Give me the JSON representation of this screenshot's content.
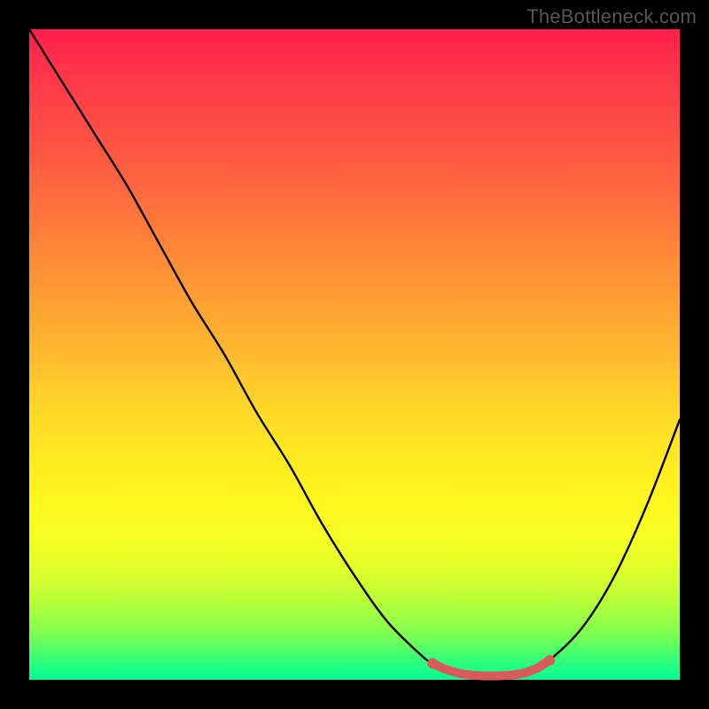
{
  "attribution": "TheBottleneck.com",
  "colors": {
    "frame": "#000000",
    "attribution_text": "#565656",
    "curve": "#000000",
    "valley_dots": "#d95a5a",
    "gradient_top": "#ff1f4a",
    "gradient_bottom": "#00ff94"
  },
  "chart_data": {
    "type": "line",
    "title": "",
    "xlabel": "",
    "ylabel": "",
    "xlim": [
      0,
      100
    ],
    "ylim": [
      0,
      100
    ],
    "x": [
      0,
      5,
      10,
      15,
      20,
      25,
      30,
      35,
      40,
      45,
      50,
      55,
      60,
      62,
      64,
      66,
      68,
      70,
      72,
      74,
      76,
      78,
      80,
      85,
      90,
      95,
      100
    ],
    "y": [
      100,
      92,
      84,
      76,
      67,
      58,
      50,
      41,
      33,
      24,
      16,
      9,
      4,
      2.5,
      1.6,
      1.0,
      0.7,
      0.6,
      0.6,
      0.7,
      1.0,
      1.7,
      3,
      8,
      16,
      27,
      40
    ],
    "valley_marker_x": [
      62,
      64,
      66,
      68,
      70,
      72,
      74,
      76,
      78,
      80
    ],
    "note": "Single-series curve against a vertical red→green gradient background. Values are relative; no numeric axis ticks visible. Curve descends steeply from top-left, reaches a near-zero minimum around x≈68–76 (marked with small red-pink dots), then rises toward the right."
  }
}
